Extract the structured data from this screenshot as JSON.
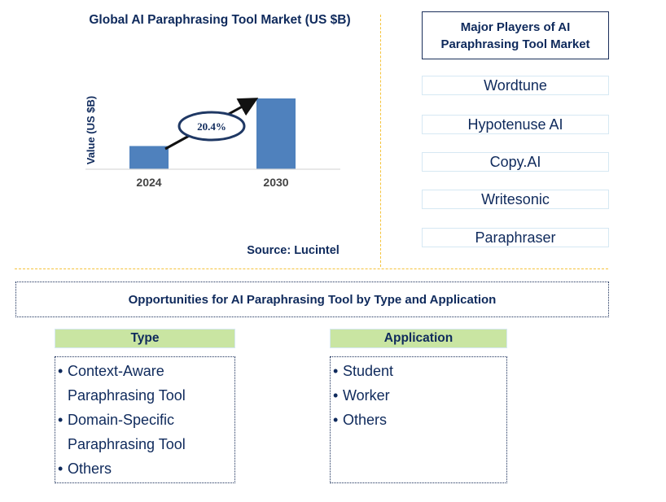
{
  "chart_data": {
    "type": "bar",
    "title": "Global AI Paraphrasing Tool Market (US $B)",
    "xlabel": "",
    "ylabel": "Value (US $B)",
    "categories": [
      "2024",
      "2030"
    ],
    "values": [
      1,
      3.05
    ],
    "values_note": "relative bar heights only; no numeric axis shown",
    "annotation": {
      "type": "cagr-arrow",
      "label": "20.4%",
      "from": "2024",
      "to": "2030"
    },
    "grid": false,
    "bar_color": "#4f81bd"
  },
  "source": "Source: Lucintel",
  "players": {
    "title": "Major Players of AI Paraphrasing Tool Market",
    "items": [
      "Wordtune",
      "Hypotenuse AI",
      "Copy.AI",
      "Writesonic",
      "Paraphraser"
    ]
  },
  "opportunities": {
    "title": "Opportunities for AI Paraphrasing Tool by Type and Application",
    "type": {
      "header": "Type",
      "items": [
        [
          "Context-Aware",
          "Paraphrasing Tool"
        ],
        [
          "Domain-Specific",
          "Paraphrasing Tool"
        ],
        [
          "Others"
        ]
      ]
    },
    "application": {
      "header": "Application",
      "items": [
        [
          "Student"
        ],
        [
          "Worker"
        ],
        [
          "Others"
        ]
      ]
    }
  },
  "colors": {
    "text": "#0f2a5c",
    "accent_divider": "#f5c33b",
    "segment_header_bg": "#c9e5a2",
    "player_border": "#d6e8f3"
  }
}
